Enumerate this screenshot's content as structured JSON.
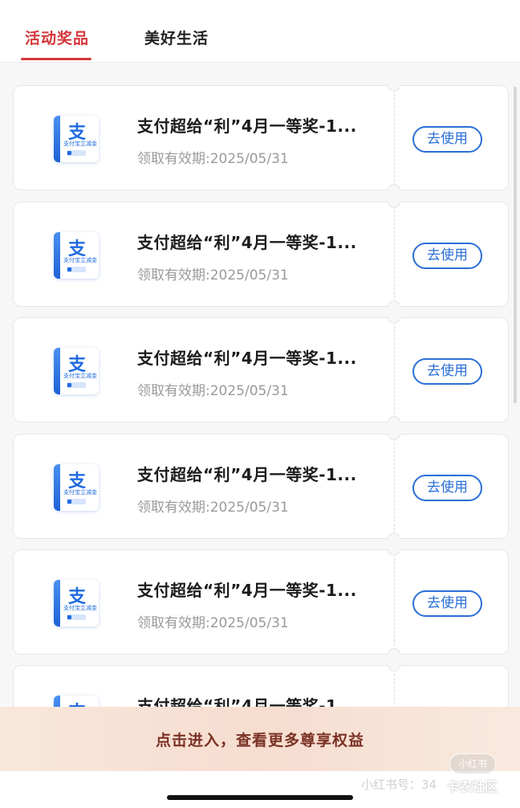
{
  "tabs": [
    {
      "label": "活动奖品",
      "active": true
    },
    {
      "label": "美好生活",
      "active": false
    }
  ],
  "coupons": [
    {
      "title": "支付超给“利”4月一等奖-1...",
      "expiry": "领取有效期:2025/05/31",
      "button": "去使用",
      "logo_glyph": "支",
      "logo_text": "支付宝立减金"
    },
    {
      "title": "支付超给“利”4月一等奖-1...",
      "expiry": "领取有效期:2025/05/31",
      "button": "去使用",
      "logo_glyph": "支",
      "logo_text": "支付宝立减金"
    },
    {
      "title": "支付超给“利”4月一等奖-1...",
      "expiry": "领取有效期:2025/05/31",
      "button": "去使用",
      "logo_glyph": "支",
      "logo_text": "支付宝立减金"
    },
    {
      "title": "支付超给“利”4月一等奖-1...",
      "expiry": "领取有效期:2025/05/31",
      "button": "去使用",
      "logo_glyph": "支",
      "logo_text": "支付宝立减金"
    },
    {
      "title": "支付超给“利”4月一等奖-1...",
      "expiry": "领取有效期:2025/05/31",
      "button": "去使用",
      "logo_glyph": "支",
      "logo_text": "支付宝立减金"
    },
    {
      "title": "支付超给“利”4月一等奖-1...",
      "expiry": "",
      "button": "",
      "logo_glyph": "支",
      "logo_text": ""
    }
  ],
  "banner": {
    "text": "点击进入，查看更多尊享权益"
  },
  "watermark": {
    "badge": "小红书",
    "id": "小红书号：34",
    "site": "卡农社区"
  },
  "colors": {
    "accent": "#d4373b",
    "button_blue": "#2a6fd6",
    "banner_text": "#7a3224"
  }
}
